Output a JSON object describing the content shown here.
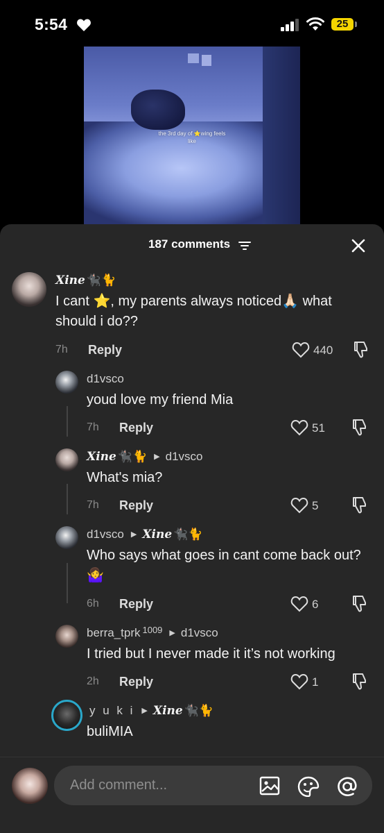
{
  "status_bar": {
    "time": "5:54",
    "battery": "25"
  },
  "video": {
    "caption_line1": "the 3rd day of ⭐wing feels",
    "caption_line2": "like"
  },
  "sheet": {
    "title": "187 comments"
  },
  "comments": [
    {
      "user": "Xine",
      "user_emojis": "🐈‍⬛🐈",
      "text": "I cant ⭐, my parents always noticed🙏🏻 what should i do??",
      "time": "7h",
      "reply_label": "Reply",
      "likes": "440"
    },
    {
      "user": "d1vsco",
      "text": "youd love my friend Mia",
      "time": "7h",
      "reply_label": "Reply",
      "likes": "51"
    },
    {
      "user": "Xine",
      "user_emojis": "🐈‍⬛🐈",
      "reply_to": "d1vsco",
      "text": "What's mia?",
      "time": "7h",
      "reply_label": "Reply",
      "likes": "5"
    },
    {
      "user": "d1vsco",
      "reply_to": "Xine",
      "reply_to_emojis": "🐈‍⬛🐈",
      "text": "Who says what goes in cant come back out? 🤷‍♀️",
      "time": "6h",
      "reply_label": "Reply",
      "likes": "6"
    },
    {
      "user": "berra_tprk",
      "user_sup": "1009",
      "reply_to": "d1vsco",
      "text": "I tried but I never made it it’s not working",
      "time": "2h",
      "reply_label": "Reply",
      "likes": "1"
    },
    {
      "user": "y u k i",
      "reply_to": "Xine",
      "reply_to_emojis": "🐈‍⬛🐈",
      "text": "buliMIA"
    }
  ],
  "composer": {
    "placeholder": "Add comment..."
  },
  "colors": {
    "sheet_bg": "#272727",
    "input_bg": "#3b3b3b",
    "battery": "#f5d500",
    "accent_ring": "#2aa7c9"
  },
  "icons": [
    "heart-icon",
    "signal-icon",
    "wifi-icon",
    "filter-icon",
    "close-icon",
    "like-heart-icon",
    "dislike-icon",
    "image-icon",
    "sticker-icon",
    "at-icon"
  ]
}
